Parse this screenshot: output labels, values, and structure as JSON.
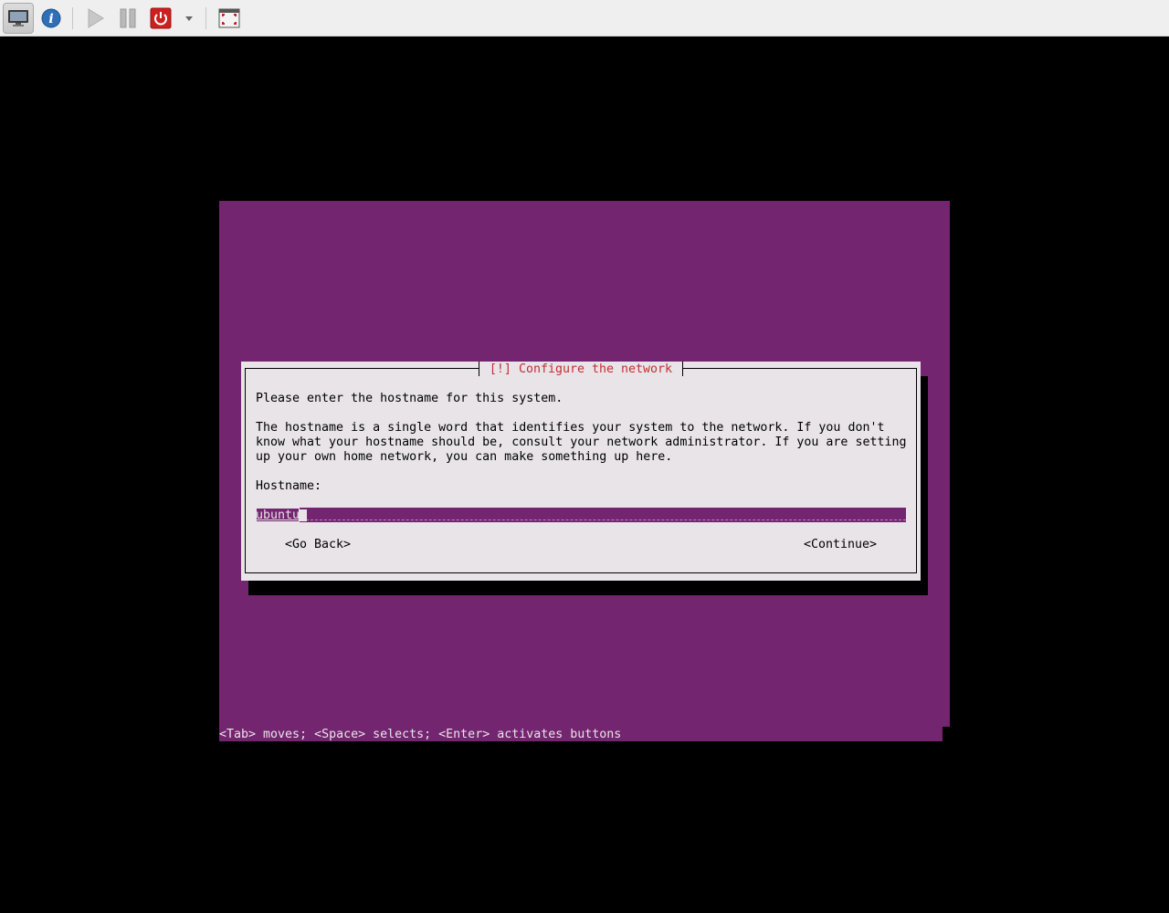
{
  "toolbar": {
    "buttons": [
      {
        "icon": "display-icon",
        "active": true
      },
      {
        "icon": "info-icon"
      },
      {
        "icon": "play-icon"
      },
      {
        "icon": "pause-icon"
      },
      {
        "icon": "power-icon"
      },
      {
        "icon": "dropdown-arrow-icon"
      },
      {
        "icon": "fullscreen-icon"
      }
    ]
  },
  "colors": {
    "installer_background": "#742570",
    "dialog_background": "#e8e4e8",
    "title_text": "#c03030"
  },
  "dialog": {
    "title": "[!] Configure the network",
    "prompt": "Please enter the hostname for this system.",
    "description_lines": [
      "The hostname is a single word that identifies your system to the network. If you don't",
      "know what your hostname should be, consult your network administrator. If you are setting",
      "up your own home network, you can make something up here."
    ],
    "field_label": "Hostname:",
    "field_value": "ubuntu",
    "go_back_label": "<Go Back>",
    "continue_label": "<Continue>"
  },
  "status_bar": "<Tab> moves; <Space> selects; <Enter> activates buttons"
}
